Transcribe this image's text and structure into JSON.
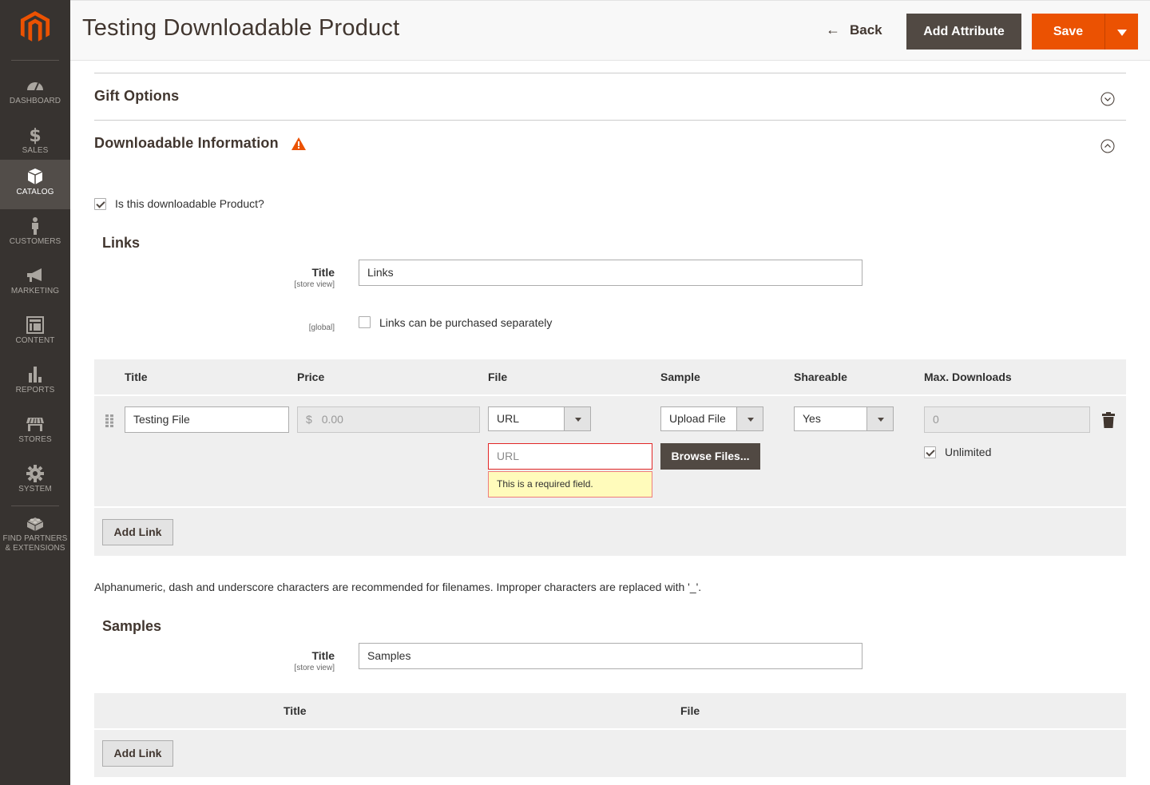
{
  "sidebar": {
    "items": [
      {
        "label": "DASHBOARD",
        "icon": "dashboard-icon"
      },
      {
        "label": "SALES",
        "icon": "dollar-icon"
      },
      {
        "label": "CATALOG",
        "icon": "box-icon",
        "active": true
      },
      {
        "label": "CUSTOMERS",
        "icon": "person-icon"
      },
      {
        "label": "MARKETING",
        "icon": "megaphone-icon"
      },
      {
        "label": "CONTENT",
        "icon": "layout-icon"
      },
      {
        "label": "REPORTS",
        "icon": "bar-chart-icon"
      },
      {
        "label": "STORES",
        "icon": "store-icon"
      },
      {
        "label": "SYSTEM",
        "icon": "gear-icon"
      }
    ],
    "extensions": {
      "line1": "FIND PARTNERS",
      "line2": "& EXTENSIONS",
      "icon": "lego-brick-icon"
    }
  },
  "header": {
    "title": "Testing Downloadable Product",
    "back_label": "Back",
    "add_attribute_label": "Add Attribute",
    "save_label": "Save"
  },
  "sections": {
    "gift_options": {
      "title": "Gift Options",
      "state": "collapsed"
    },
    "downloadable": {
      "title": "Downloadable Information",
      "state": "expanded",
      "has_warning": true
    }
  },
  "downloadable": {
    "is_downloadable_label": "Is this downloadable Product?",
    "is_downloadable_checked": true,
    "links": {
      "heading": "Links",
      "title_label": "Title",
      "title_scope": "[store view]",
      "title_value": "Links",
      "separately_scope": "[global]",
      "separately_label": "Links can be purchased separately",
      "separately_checked": false,
      "columns": [
        "Title",
        "Price",
        "File",
        "Sample",
        "Shareable",
        "Max. Downloads"
      ],
      "rows": [
        {
          "title": "Testing File",
          "price_currency": "$",
          "price": "0.00",
          "file_type": "URL",
          "file_url_placeholder": "URL",
          "file_error": "This is a required field.",
          "sample_type": "Upload File",
          "browse_label": "Browse Files...",
          "shareable": "Yes",
          "max_downloads": "0",
          "unlimited_label": "Unlimited",
          "unlimited_checked": true
        }
      ],
      "add_link_label": "Add Link"
    },
    "filename_note": "Alphanumeric, dash and underscore characters are recommended for filenames. Improper characters are replaced with '_'.",
    "samples": {
      "heading": "Samples",
      "title_label": "Title",
      "title_scope": "[store view]",
      "title_value": "Samples",
      "columns": [
        "Title",
        "File"
      ],
      "add_link_label": "Add Link"
    }
  },
  "colors": {
    "brand_orange": "#eb5202",
    "sidebar_bg": "#373330",
    "dark_button": "#514943",
    "error_border": "#e22626",
    "error_bg": "#fffbbb"
  }
}
